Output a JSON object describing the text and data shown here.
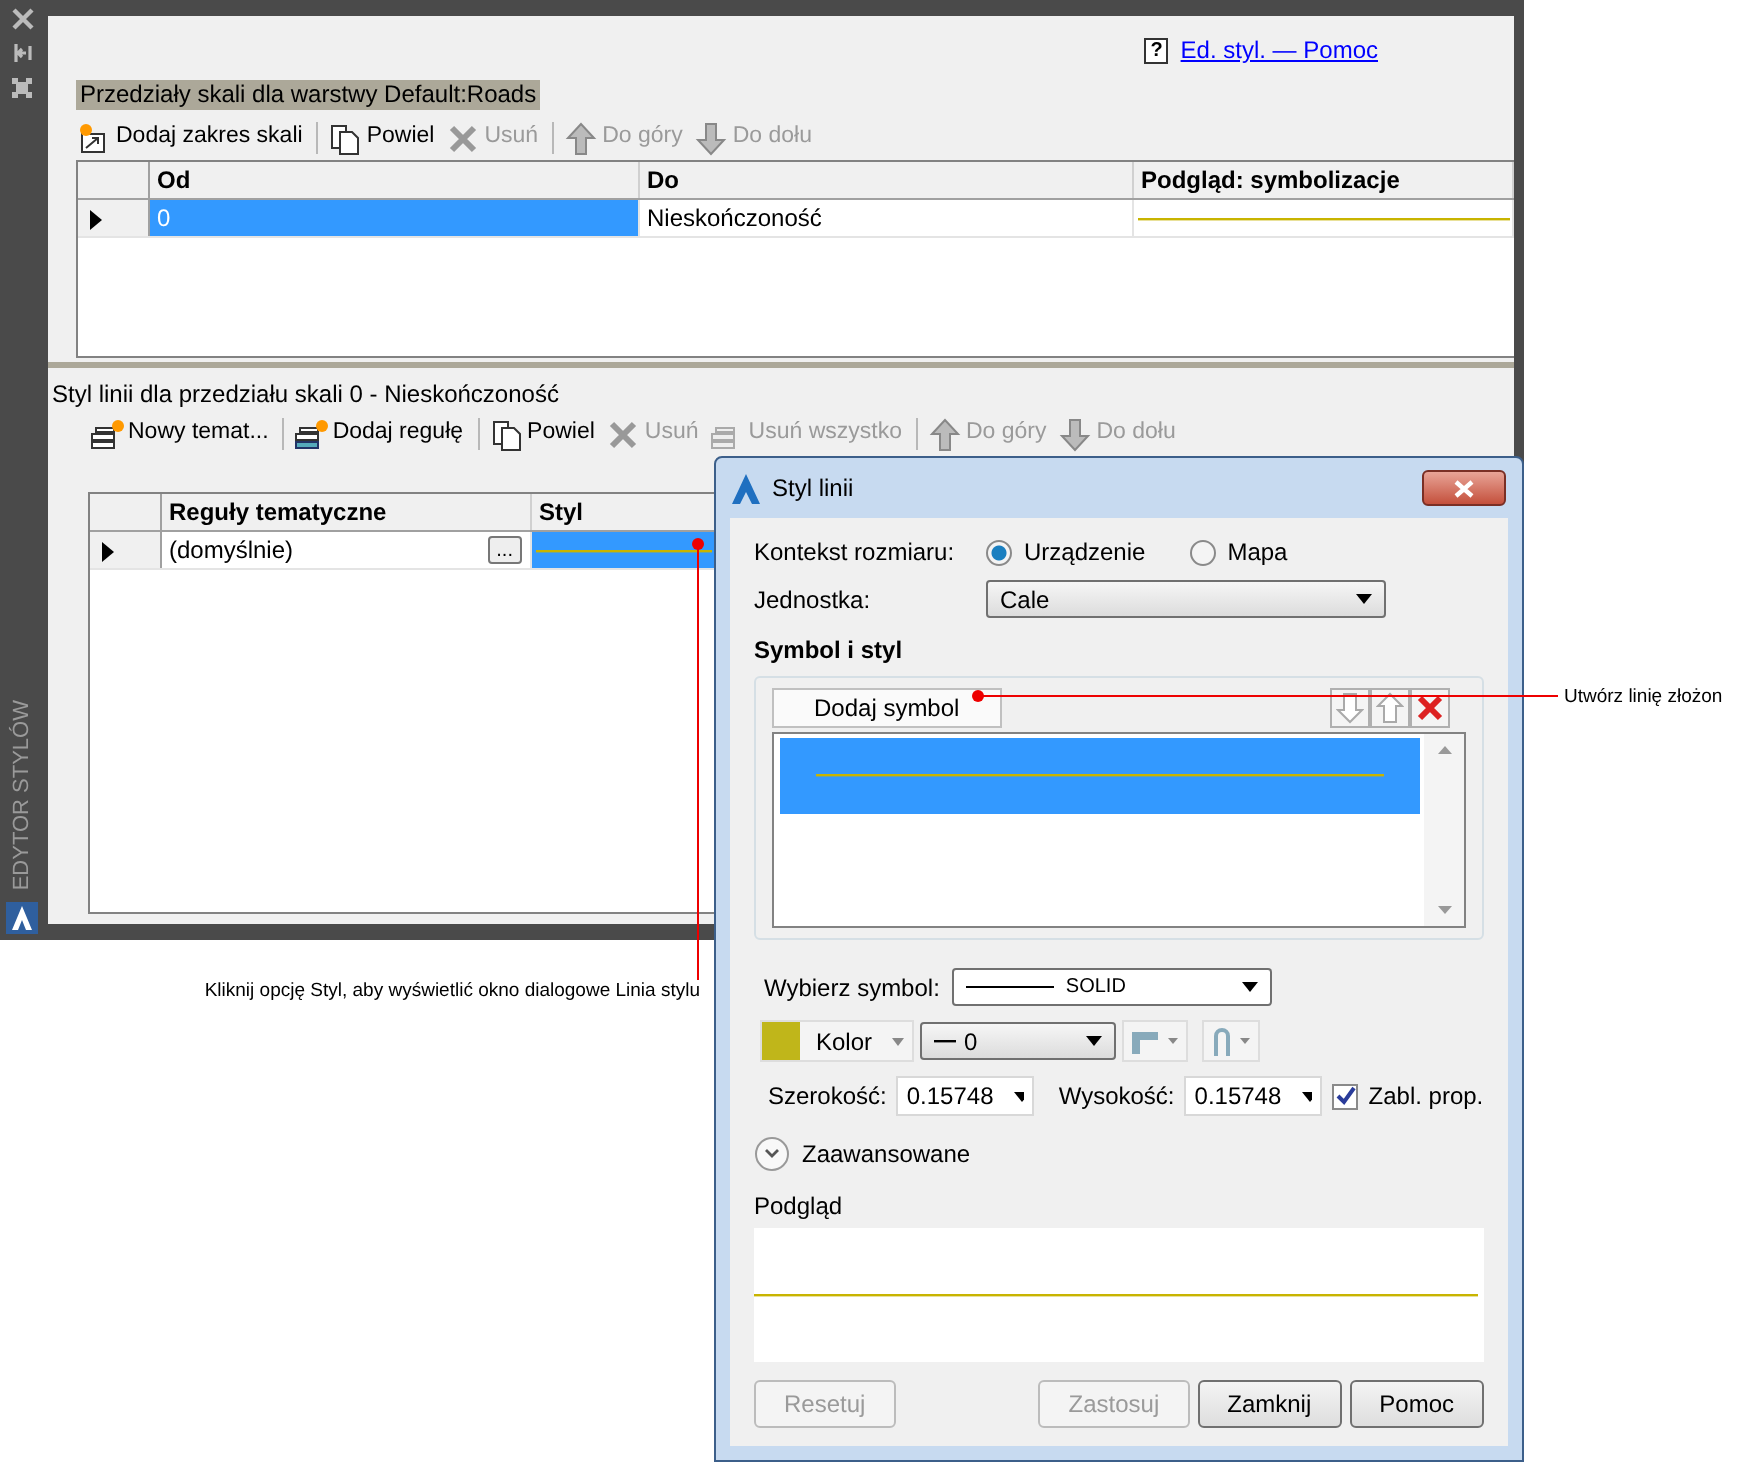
{
  "side_panel": {
    "title": "EDYTOR STYLÓW"
  },
  "help_link": {
    "icon_text": "?",
    "label": "Ed. styl. — Pomoc"
  },
  "scale_ranges": {
    "title": "Przedziały skali dla warstwy Default:Roads",
    "toolbar": [
      {
        "kind": "add-range",
        "label": "Dodaj zakres skali",
        "disabled": false
      },
      {
        "kind": "copy",
        "label": "Powiel",
        "disabled": false
      },
      {
        "kind": "delete",
        "label": "Usuń",
        "disabled": true
      },
      {
        "kind": "up",
        "label": "Do góry",
        "disabled": true
      },
      {
        "kind": "down",
        "label": "Do dołu",
        "disabled": true
      }
    ],
    "columns": [
      "Od",
      "Do",
      "Podgląd: symbolizacje"
    ],
    "rows": [
      {
        "from": "0",
        "to": "Nieskończoność",
        "selected": true
      }
    ]
  },
  "line_styles": {
    "title": "Styl linii dla przedziału skali 0 - Nieskończoność",
    "toolbar": [
      {
        "kind": "new-theme",
        "label": "Nowy temat...",
        "disabled": false
      },
      {
        "kind": "add-rule",
        "label": "Dodaj regułę",
        "disabled": false
      },
      {
        "kind": "copy",
        "label": "Powiel",
        "disabled": false
      },
      {
        "kind": "delete",
        "label": "Usuń",
        "disabled": true
      },
      {
        "kind": "delete-all",
        "label": "Usuń wszystko",
        "disabled": true
      },
      {
        "kind": "up",
        "label": "Do góry",
        "disabled": true
      },
      {
        "kind": "down",
        "label": "Do dołu",
        "disabled": true
      }
    ],
    "columns": [
      "Reguły tematyczne",
      "Styl"
    ],
    "rows": [
      {
        "rule": "(domyślnie)",
        "edit_button": "...",
        "selected": true
      }
    ]
  },
  "dialog": {
    "title": "Styl linii",
    "size_context": {
      "label": "Kontekst rozmiaru:",
      "options": [
        {
          "label": "Urządzenie",
          "selected": true
        },
        {
          "label": "Mapa",
          "selected": false
        }
      ]
    },
    "unit": {
      "label": "Jednostka:",
      "value": "Cale"
    },
    "section_title": "Symbol i styl",
    "add_symbol": "Dodaj symbol",
    "symbols": [
      {
        "selected": true
      }
    ],
    "symbol_select": {
      "label": "Wybierz symbol:",
      "value": "SOLID"
    },
    "color": {
      "label": "Kolor",
      "color": "#c0b61a"
    },
    "line_weight": {
      "value": "0"
    },
    "width": {
      "label": "Szerokość:",
      "value": "0.15748"
    },
    "height": {
      "label": "Wysokość:",
      "value": "0.15748"
    },
    "lock": {
      "label": "Zabl. prop.",
      "checked": true
    },
    "advanced": {
      "label": "Zaawansowane",
      "expanded": false
    },
    "preview": {
      "label": "Podgląd"
    },
    "buttons": [
      {
        "label": "Resetuj",
        "disabled": true
      },
      {
        "label": "Zastosuj",
        "disabled": true
      },
      {
        "label": "Zamknij",
        "disabled": false
      },
      {
        "label": "Pomoc",
        "disabled": false
      }
    ]
  },
  "callouts": [
    {
      "text": "Kliknij opcję Styl, aby wyświetlić okno dialogowe Linia stylu"
    },
    {
      "text": "Utwórz linię złożon"
    }
  ]
}
